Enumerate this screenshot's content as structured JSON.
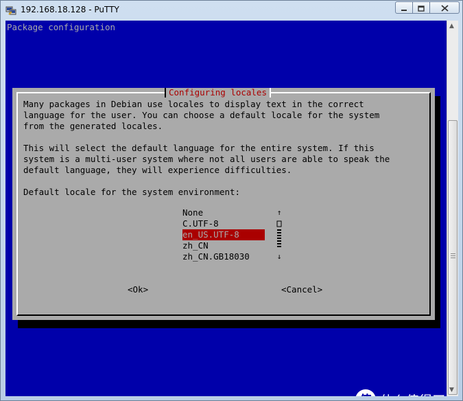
{
  "window": {
    "title": "192.168.18.128 - PuTTY",
    "controls": {
      "minimize": "minimize",
      "maximize": "maximize",
      "close": "close"
    }
  },
  "terminal": {
    "header": "Package configuration",
    "colors": {
      "background": "#0000aa",
      "dialog": "#aaaaaa",
      "title": "#aa0000",
      "selected": "#aa0000"
    },
    "dialog": {
      "title": "Configuring locales",
      "lines": [
        "Many packages in Debian use locales to display text in the correct",
        "language for the user. You can choose a default locale for the system",
        "from the generated locales.",
        "",
        "This will select the default language for the entire system. If this",
        "system is a multi-user system where not all users are able to speak the",
        "default language, they will experience difficulties.",
        "",
        "Default locale for the system environment:"
      ],
      "options": [
        "None",
        "C.UTF-8",
        "en_US.UTF-8",
        "zh_CN",
        "zh_CN.GB18030"
      ],
      "selected_option": "en_US.UTF-8",
      "ok_label": "<Ok>",
      "cancel_label": "<Cancel>"
    }
  },
  "watermark": {
    "badge": "值",
    "text": "什么值得买"
  }
}
